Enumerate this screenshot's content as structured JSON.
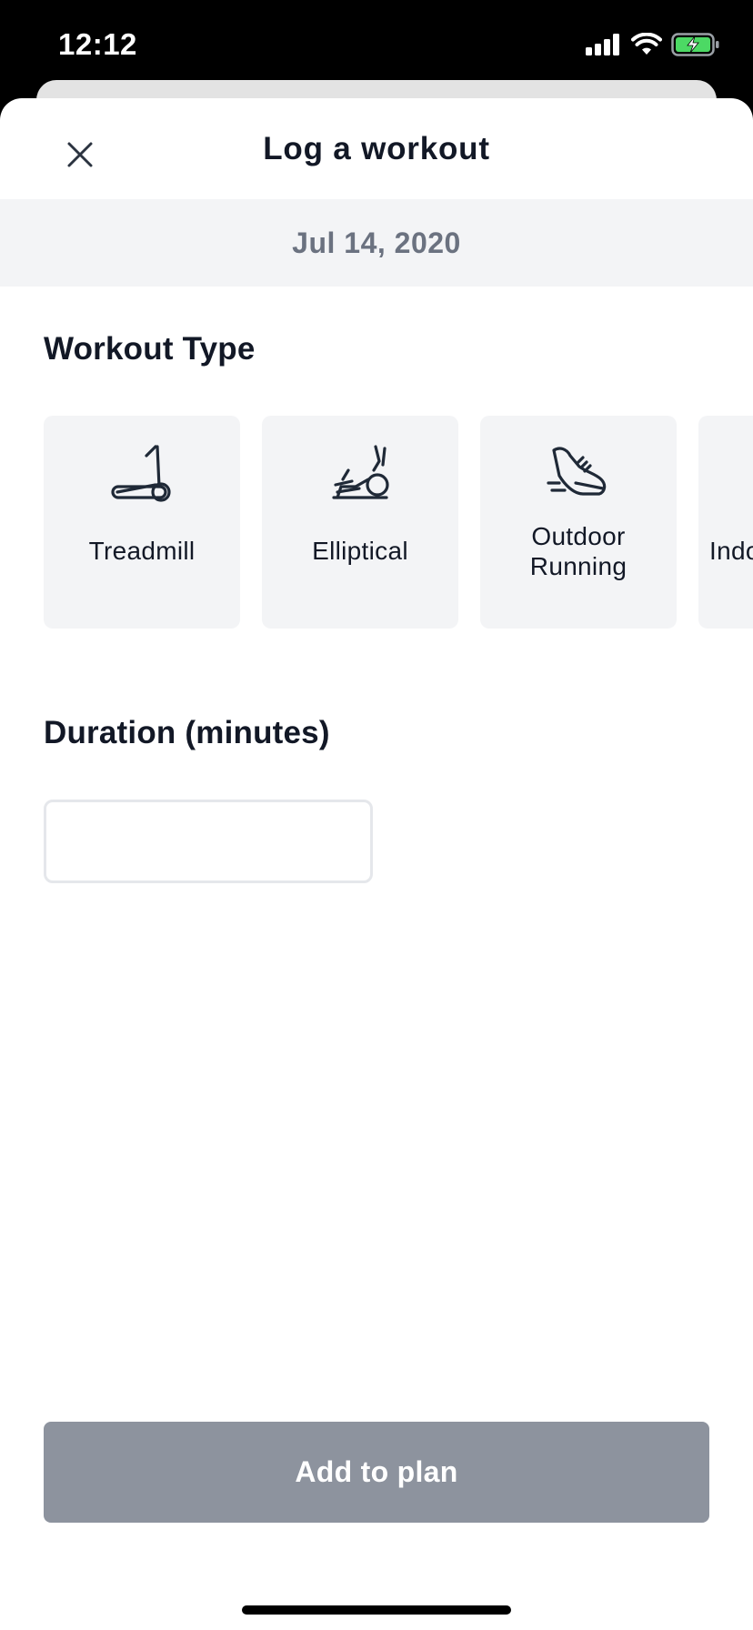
{
  "status_bar": {
    "time": "12:12",
    "icons": [
      "cellular-signal-icon",
      "wifi-icon",
      "battery-charging-icon"
    ],
    "battery_color": "#4cd964"
  },
  "header": {
    "title": "Log a workout",
    "close_icon": "close-icon"
  },
  "date_label": "Jul 14, 2020",
  "workout_type": {
    "title": "Workout Type",
    "options": [
      {
        "label": "Treadmill",
        "icon": "treadmill-icon"
      },
      {
        "label": "Elliptical",
        "icon": "elliptical-icon"
      },
      {
        "label": "Outdoor Running",
        "icon": "running-shoe-icon"
      },
      {
        "label": "Indo",
        "icon": ""
      }
    ]
  },
  "duration": {
    "title": "Duration (minutes)",
    "value": "",
    "placeholder": ""
  },
  "primary_button": {
    "label": "Add to plan",
    "color": "#8d939e"
  }
}
